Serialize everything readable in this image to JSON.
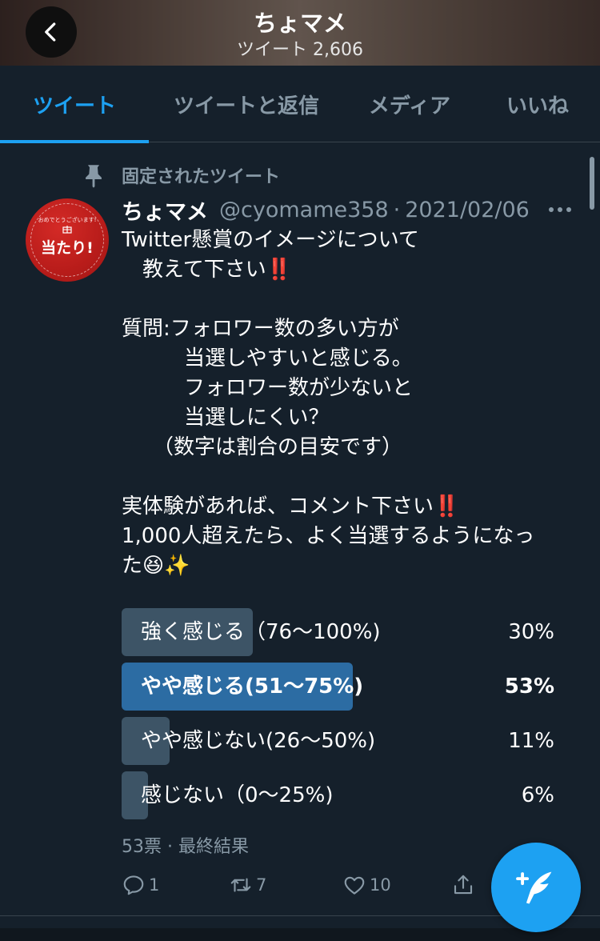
{
  "header": {
    "title": "ちょマメ",
    "subtitle": "ツイート 2,606"
  },
  "tabs": [
    {
      "label": "ツイート",
      "active": true
    },
    {
      "label": "ツイートと返信",
      "active": false
    },
    {
      "label": "メディア",
      "active": false
    },
    {
      "label": "いいね",
      "active": false
    }
  ],
  "pinned": {
    "label": "固定されたツイート",
    "icon": "pin-icon"
  },
  "avatar": {
    "small_text": "おめでとうございます!",
    "main_text": "当たり!"
  },
  "tweet": {
    "name": "ちょマメ",
    "handle": "@cyomame358",
    "separator": "·",
    "date": "2021/02/06",
    "lines": [
      "Twitter懸賞のイメージについて",
      "　教えて下さい",
      "",
      "質問:フォロワー数の多い方が",
      "　　　当選しやすいと感じる。",
      "　　　フォロワー数が少ないと",
      "　　　当選しにくい？",
      "　　（数字は割合の目安です）",
      "",
      "実体験があれば、コメント下さい",
      "1,000人超えたら、よく当選するようになっ",
      "た"
    ],
    "emphasis": "‼️",
    "emoji_laugh": "😆",
    "emoji_sparkle": "✨"
  },
  "poll": {
    "options": [
      {
        "label": "強く感じる（76〜100%)",
        "percent_label": "30%",
        "share": 0.3,
        "winner": false
      },
      {
        "label": "やや感じる(51〜75%)",
        "percent_label": "53%",
        "share": 0.53,
        "winner": true
      },
      {
        "label": "やや感じない(26〜50%)",
        "percent_label": "11%",
        "share": 0.11,
        "winner": false
      },
      {
        "label": "感じない（0〜25%)",
        "percent_label": "6%",
        "share": 0.06,
        "winner": false
      }
    ],
    "meta": "53票 · 最終結果"
  },
  "actions": {
    "reply_count": "1",
    "retweet_count": "7",
    "like_count": "10"
  },
  "colors": {
    "background": "#15202b",
    "accent": "#1da1f2",
    "muted": "#8899a6",
    "bar": "#3d5466",
    "bar_winner": "#2c6ca3",
    "alert": "#e0245e"
  }
}
